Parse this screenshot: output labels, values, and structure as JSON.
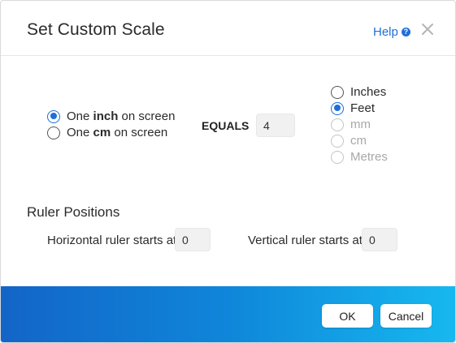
{
  "dialog": {
    "title": "Set Custom Scale",
    "help_label": "Help",
    "help_icon": "question-circle-icon",
    "close_icon": "close-icon"
  },
  "scale": {
    "screen_units": [
      {
        "label_pre": "One ",
        "label_bold": "inch",
        "label_post": " on screen",
        "checked": true
      },
      {
        "label_pre": "One ",
        "label_bold": "cm",
        "label_post": " on screen",
        "checked": false
      }
    ],
    "equals_label": "EQUALS",
    "value": "4",
    "real_units": [
      {
        "label": "Inches",
        "checked": false,
        "disabled": false
      },
      {
        "label": "Feet",
        "checked": true,
        "disabled": false
      },
      {
        "label": "mm",
        "checked": false,
        "disabled": true
      },
      {
        "label": "cm",
        "checked": false,
        "disabled": true
      },
      {
        "label": "Metres",
        "checked": false,
        "disabled": true
      }
    ]
  },
  "ruler": {
    "title": "Ruler Positions",
    "horizontal_label": "Horizontal ruler starts at",
    "horizontal_value": "0",
    "vertical_label": "Vertical ruler starts at",
    "vertical_value": "0"
  },
  "footer": {
    "ok_label": "OK",
    "cancel_label": "Cancel"
  },
  "colors": {
    "accent": "#1e6fd9",
    "footer_gradient_start": "#1365c7",
    "footer_gradient_end": "#17b8f0"
  }
}
